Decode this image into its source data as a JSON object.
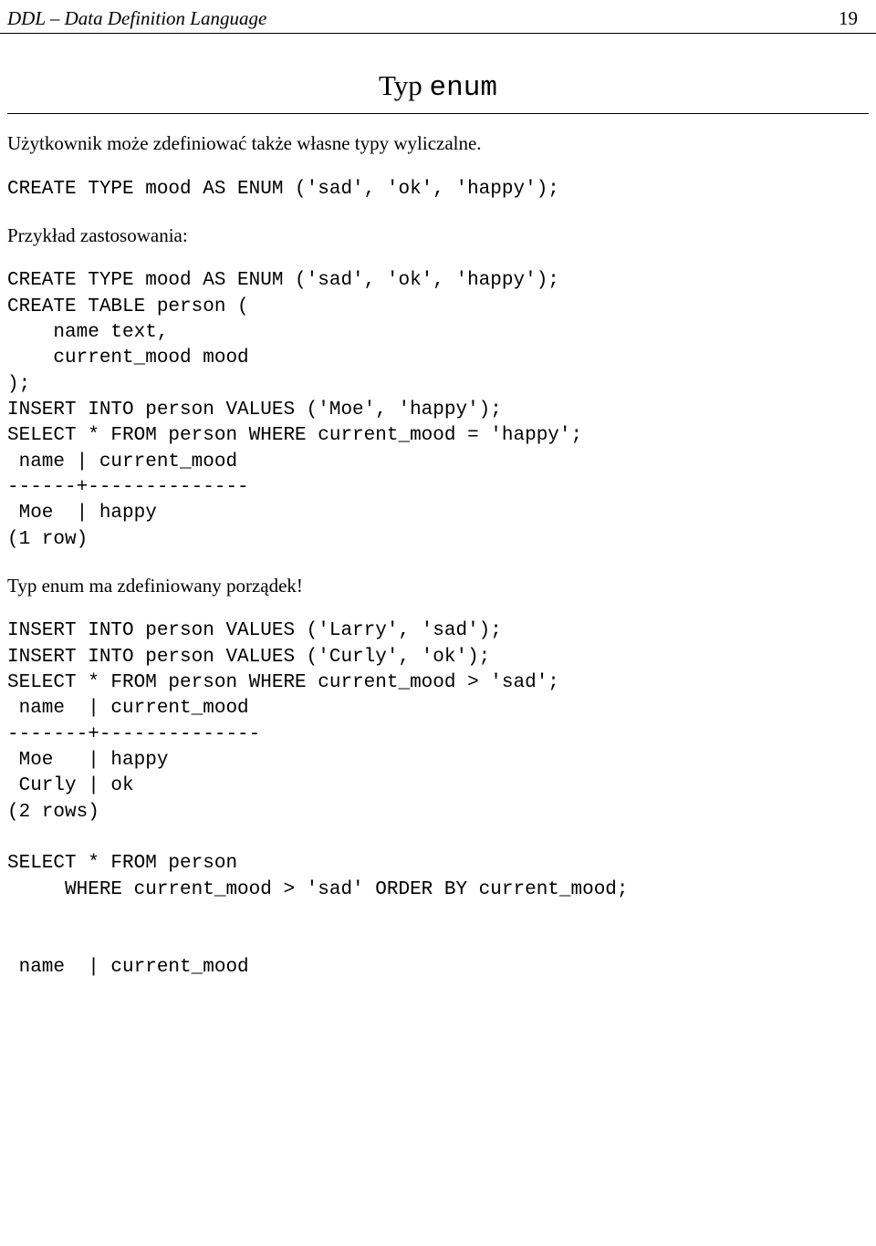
{
  "header": {
    "left": "DDL – Data Definition Language",
    "right": "19"
  },
  "title": {
    "word1": "Typ",
    "word2": "enum"
  },
  "para1": "Użytkownik może zdefiniować także własne typy wyliczalne.",
  "code1": "CREATE TYPE mood AS ENUM ('sad', 'ok', 'happy');",
  "para2": "Przykład zastosowania:",
  "code2": "CREATE TYPE mood AS ENUM ('sad', 'ok', 'happy');\nCREATE TABLE person (\n    name text,\n    current_mood mood\n);\nINSERT INTO person VALUES ('Moe', 'happy');\nSELECT * FROM person WHERE current_mood = 'happy';\n name | current_mood\n------+--------------\n Moe  | happy\n(1 row)",
  "para3": "Typ enum ma zdefiniowany porządek!",
  "code3": "INSERT INTO person VALUES ('Larry', 'sad');\nINSERT INTO person VALUES ('Curly', 'ok');\nSELECT * FROM person WHERE current_mood > 'sad';\n name  | current_mood\n-------+--------------\n Moe   | happy\n Curly | ok\n(2 rows)\n\nSELECT * FROM person\n     WHERE current_mood > 'sad' ORDER BY current_mood;\n\n\n name  | current_mood"
}
